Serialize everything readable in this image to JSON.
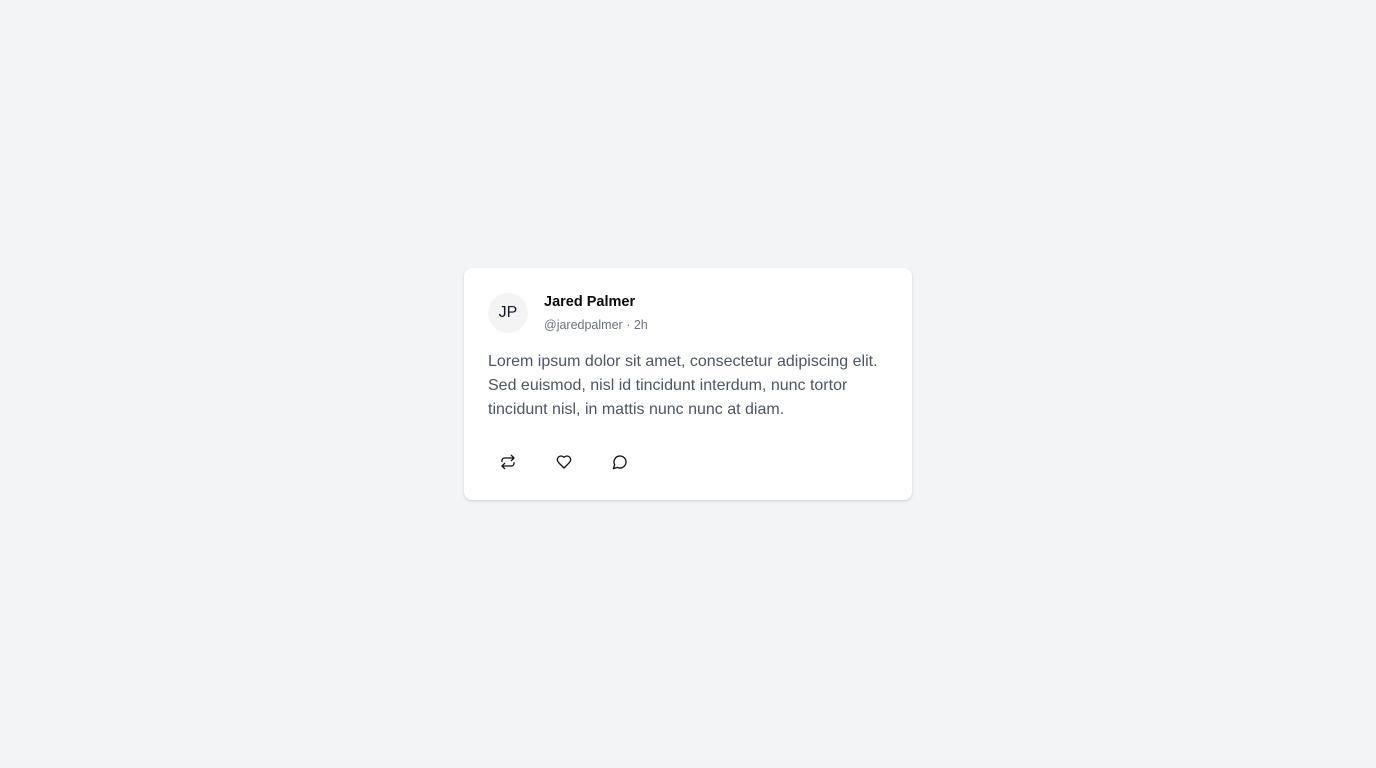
{
  "post": {
    "avatar_initials": "JP",
    "author_name": "Jared Palmer",
    "handle": "@jaredpalmer",
    "separator": "·",
    "time": "2h",
    "text": "Lorem ipsum dolor sit amet, consectetur adipiscing elit. Sed euismod, nisl id tincidunt interdum, nunc tortor tincidunt nisl, in mattis nunc nunc at diam.",
    "actions": [
      {
        "icon": "repost-icon"
      },
      {
        "icon": "heart-icon"
      },
      {
        "icon": "comment-icon"
      }
    ]
  },
  "colors": {
    "background": "#f3f4f6",
    "card": "#ffffff",
    "text_primary": "#0a0a0a",
    "text_secondary": "#6b7280",
    "text_body": "#4b5563",
    "avatar_bg": "#f4f4f5"
  }
}
